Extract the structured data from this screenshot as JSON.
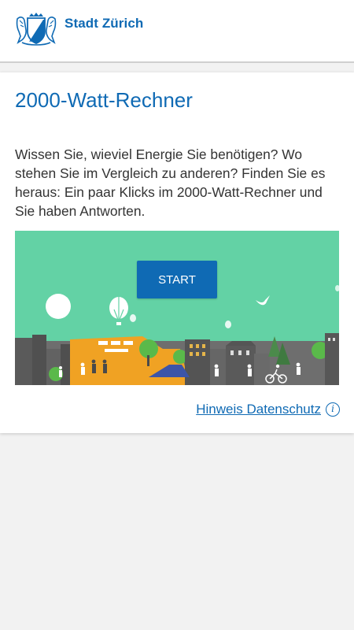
{
  "header": {
    "brand": "Stadt Zürich",
    "logo_icon": "zurich-coat-of-arms-icon"
  },
  "card": {
    "title": "2000-Watt-Rechner",
    "intro": "Wissen Sie, wieviel Energie Sie benötigen? Wo stehen Sie im Vergleich zu anderen? Finden Sie es heraus: Ein paar Klicks im 2000-Watt-Rechner und Sie haben Antworten.",
    "start_label": "START",
    "privacy_label": "Hinweis Datenschutz",
    "privacy_icon": "info-icon"
  },
  "colors": {
    "brand_blue": "#0f6ab4",
    "illustration_sky": "#63d2a5",
    "text": "#333333"
  }
}
